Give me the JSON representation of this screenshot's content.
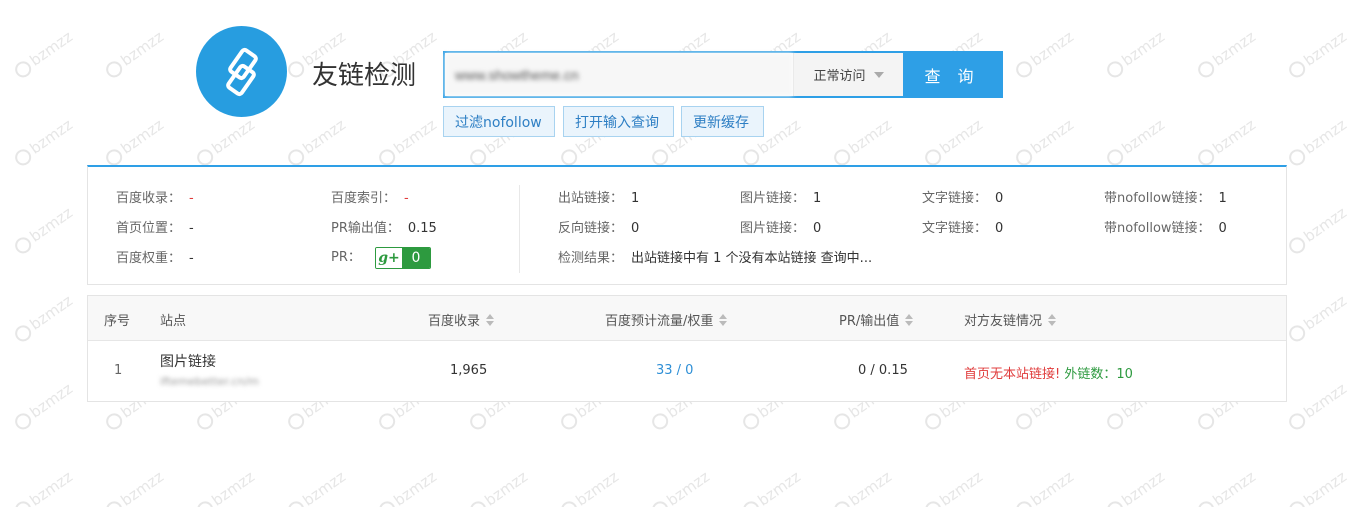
{
  "page_title": "友链检测",
  "search": {
    "value": "www.showtheme.cn",
    "visit_mode": "正常访问",
    "query_label": "查 询"
  },
  "options": [
    {
      "label": "过滤nofollow"
    },
    {
      "label": "打开输入查询"
    },
    {
      "label": "更新缓存"
    }
  ],
  "stats_left": [
    {
      "label": "百度收录：",
      "value": "-"
    },
    {
      "label": "首页位置：",
      "value": "-"
    },
    {
      "label": "百度权重：",
      "value": "-"
    },
    {
      "label": "百度索引：",
      "value": "-"
    },
    {
      "label": "PR输出值：",
      "value": "0.15"
    },
    {
      "label": "PR：",
      "value": "0",
      "badge": "g+"
    }
  ],
  "stats_right": [
    {
      "label": "出站链接：",
      "value": "1"
    },
    {
      "label": "图片链接：",
      "value": "1"
    },
    {
      "label": "文字链接：",
      "value": "0"
    },
    {
      "label": "带nofollow链接：",
      "value": "1"
    },
    {
      "label": "反向链接：",
      "value": "0"
    },
    {
      "label": "图片链接：",
      "value": "0"
    },
    {
      "label": "文字链接：",
      "value": "0"
    },
    {
      "label": "带nofollow链接：",
      "value": "0"
    }
  ],
  "result": {
    "label": "检测结果：",
    "text": "出站链接中有 1 个没有本站链接 查询中..."
  },
  "table": {
    "headers": [
      "序号",
      "站点",
      "百度收录",
      "百度预计流量/权重",
      "PR/输出值",
      "对方友链情况"
    ],
    "rows": [
      {
        "index": "1",
        "site_name": "图片链接",
        "site_domain": "iftemebetter.cn/m",
        "baidu_index": "1,965",
        "traffic_weight": "33 / 0",
        "pr_output": "0 / 0.15",
        "status_warning": "首页无本站链接!",
        "outlinks_label": "外链数：",
        "outlinks_value": "10"
      }
    ]
  },
  "watermark": "bzmzz",
  "colors": {
    "accent": "#2e9fe6",
    "warning": "#e03c3c",
    "success": "#2d9a3f"
  }
}
